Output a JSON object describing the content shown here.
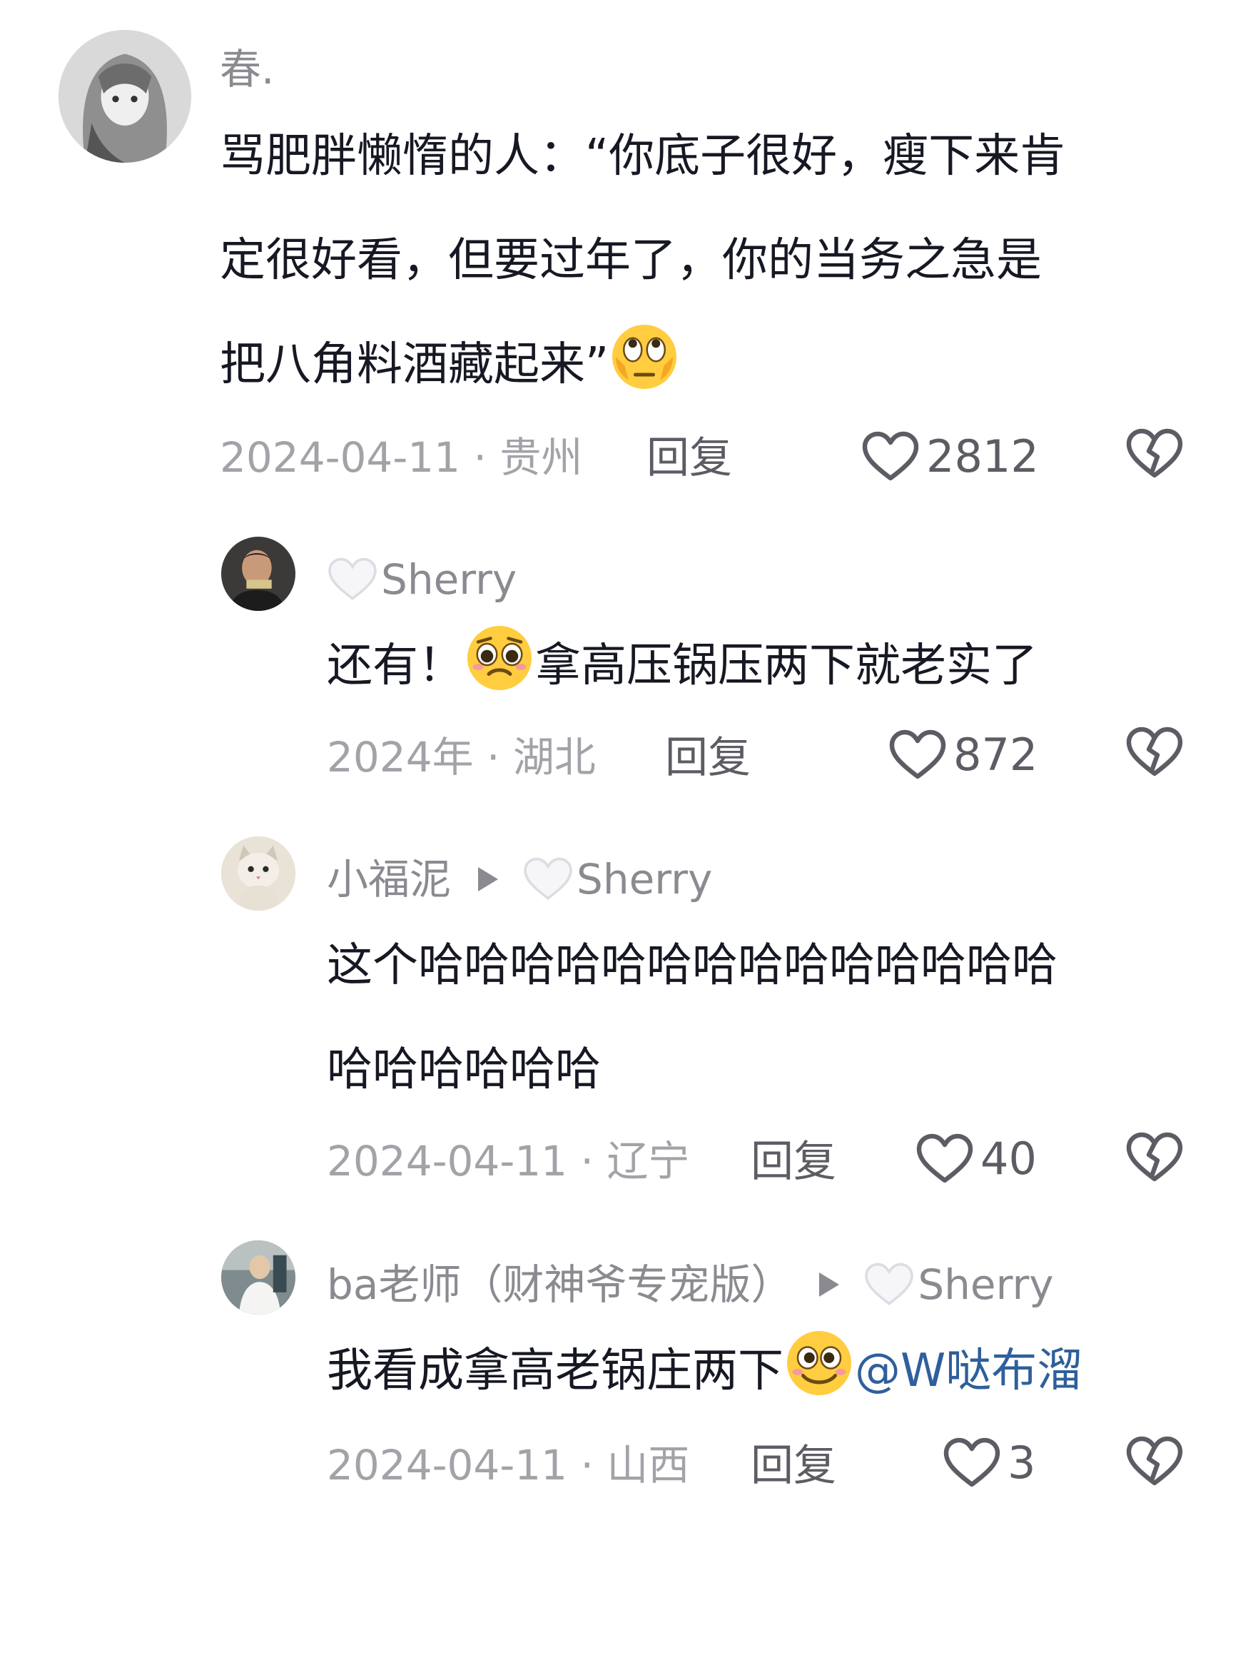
{
  "comments": [
    {
      "user": "春.",
      "text_lines": [
        "骂肥胖懒惰的人：“你底子很好，瘦下来肯",
        "定很好看，但要过年了，你的当务之急是",
        "把八角料酒藏起来”"
      ],
      "emoji": "eye-roll-emoji",
      "date_location": "2024-04-11 · 贵州",
      "reply": "回复",
      "likes": "2812"
    },
    {
      "user": "Sherry",
      "text_before": "还有！",
      "emoji": "pleading-emoji",
      "text_after": "拿高压锅压两下就老实了",
      "date_location": "2024年 · 湖北",
      "reply": "回复",
      "likes": "872"
    },
    {
      "user": "小福泥",
      "reply_to": "Sherry",
      "text_lines": [
        "这个哈哈哈哈哈哈哈哈哈哈哈哈哈哈",
        "哈哈哈哈哈哈"
      ],
      "date_location": "2024-04-11 · 辽宁",
      "reply": "回复",
      "likes": "40"
    },
    {
      "user": "ba老师（财神爷专宠版）",
      "reply_to": "Sherry",
      "text_before": "我看成拿高老锅庄两下",
      "emoji": "smile-emoji",
      "mention": "@W哒布溜",
      "date_location": "2024-04-11 · 山西",
      "reply": "回复",
      "likes": "3"
    }
  ],
  "colors": {
    "text": "#161823",
    "meta": "#a2a3a8",
    "mention": "#2f5f9c"
  }
}
